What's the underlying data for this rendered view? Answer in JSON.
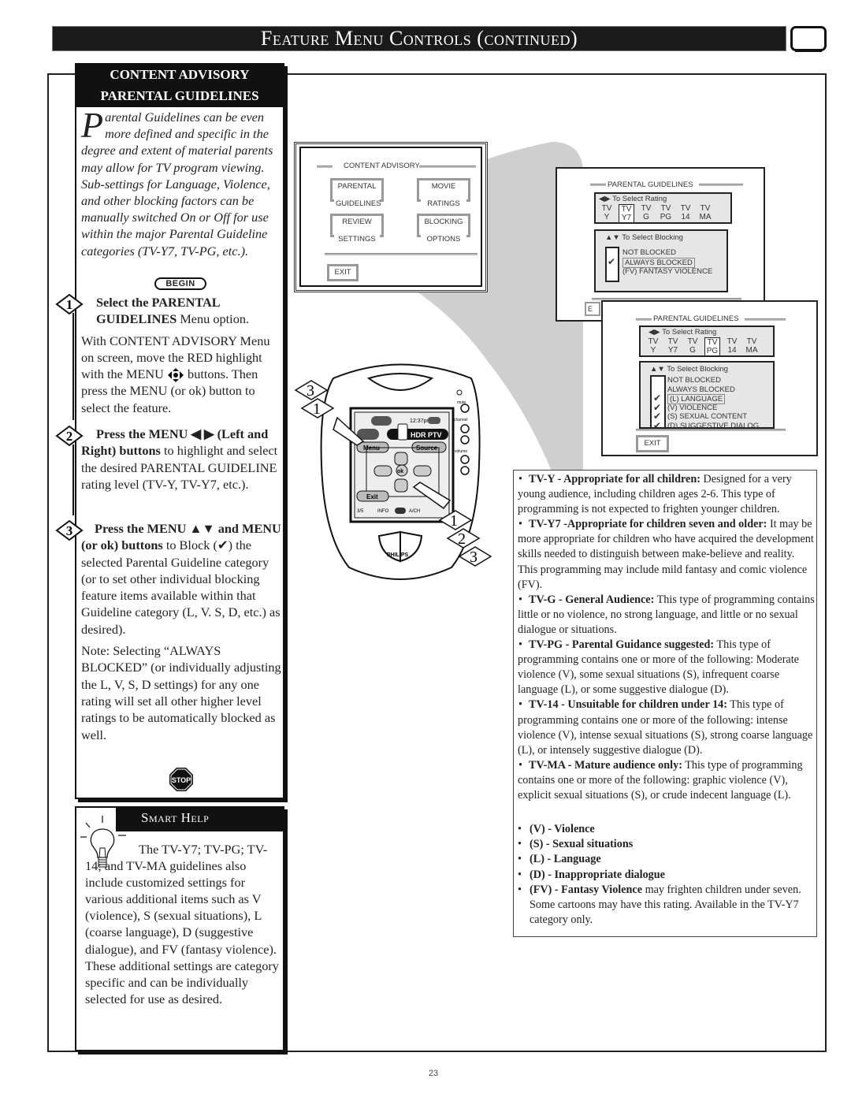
{
  "header": {
    "title": "Feature Menu Controls (continued)",
    "tv_icon": "tv-screen-icon"
  },
  "intro": {
    "heading_line1": "CONTENT ADVISORY",
    "heading_line2": "PARENTAL GUIDELINES",
    "dropcap": "P",
    "body": "arental Guidelines can be even more defined and specific in the degree and extent of material parents may allow for TV program viewing. Sub-settings for Language, Violence, and other blocking factors can be manually switched On or Off for use within the major Parental Guideline categories (TV-Y7, TV-PG, etc.).",
    "begin_label": "BEGIN"
  },
  "steps": [
    {
      "number": "1",
      "bold_lead": "Select the PARENTAL GUIDELINES",
      "lead_rest": " Menu option.",
      "body": "With CONTENT ADVISORY Menu on screen, move the RED highlight with the MENU ",
      "body_icon": "four-way-arrows-icon",
      "body_rest": " buttons. Then press the MENU (or ok) button to select the feature."
    },
    {
      "number": "2",
      "bold_lead": "Press the MENU ◀ ▶ (Left and Right) buttons",
      "lead_rest": " to highlight and select the desired PARENTAL GUIDELINE rating level (TV-Y, TV-Y7, etc.)."
    },
    {
      "number": "3",
      "bold_lead": "Press the MENU ▲▼ and MENU (or ok) buttons",
      "lead_rest": " to Block (✔) the selected Parental Guideline category (or to set other individual  blocking feature items available within that Guideline category (L, V. S, D, etc.) as desired).",
      "note": "Note: Selecting “ALWAYS BLOCKED” (or individually adjusting the L, V, S, D settings) for any one rating will set all other higher level ratings to be automatically blocked as well."
    }
  ],
  "stop_label": "STOP",
  "smart_help": {
    "title": "Smart Help",
    "body": "The TV-Y7; TV-PG; TV-14; and TV-MA guidelines also include customized settings for various additional items such as V (violence), S (sexual situations), L (coarse language), D (suggestive dialogue), and FV (fantasy violence). These additional settings are category specific and can be individually selected for use as desired."
  },
  "screen1": {
    "title": "CONTENT ADVISORY",
    "buttons": [
      {
        "line1": "PARENTAL",
        "line2": "GUIDELINES"
      },
      {
        "line1": "MOVIE",
        "line2": "RATINGS"
      },
      {
        "line1": "REVIEW",
        "line2": "SETTINGS"
      },
      {
        "line1": "BLOCKING",
        "line2": "OPTIONS"
      }
    ],
    "exit": "EXIT"
  },
  "screen2": {
    "title": "PARENTAL GUIDELINES",
    "rating_hint": "To Select Rating",
    "ratings": [
      {
        "top": "TV",
        "bottom": "Y"
      },
      {
        "top": "TV",
        "bottom": "Y7"
      },
      {
        "top": "TV",
        "bottom": "G"
      },
      {
        "top": "TV",
        "bottom": "PG"
      },
      {
        "top": "TV",
        "bottom": "14"
      },
      {
        "top": "TV",
        "bottom": "MA"
      }
    ],
    "selected_rating": "Y7",
    "blocking_hint": "To Select Blocking",
    "items": [
      {
        "label": "NOT BLOCKED",
        "checked": false,
        "highlight": false
      },
      {
        "label": "ALWAYS BLOCKED",
        "checked": true,
        "highlight": true
      },
      {
        "label": "(FV) FANTASY VIOLENCE",
        "checked": false,
        "highlight": false
      }
    ],
    "exit": "EXIT"
  },
  "screen3": {
    "title": "PARENTAL GUIDELINES",
    "rating_hint": "To Select Rating",
    "ratings": [
      {
        "top": "TV",
        "bottom": "Y"
      },
      {
        "top": "TV",
        "bottom": "Y7"
      },
      {
        "top": "TV",
        "bottom": "G"
      },
      {
        "top": "TV",
        "bottom": "PG"
      },
      {
        "top": "TV",
        "bottom": "14"
      },
      {
        "top": "TV",
        "bottom": "MA"
      }
    ],
    "selected_rating": "PG",
    "blocking_hint": "To Select Blocking",
    "items": [
      {
        "label": "NOT BLOCKED",
        "checked": false,
        "highlight": false
      },
      {
        "label": "ALWAYS BLOCKED",
        "checked": false,
        "highlight": false
      },
      {
        "label": "(L) LANGUAGE",
        "checked": true,
        "highlight": true
      },
      {
        "label": "(V) VIOLENCE",
        "checked": true,
        "highlight": false
      },
      {
        "label": "(S) SEXUAL CONTENT",
        "checked": true,
        "highlight": false
      },
      {
        "label": "(D) SUGGESTIVE DIALOG",
        "checked": true,
        "highlight": false
      }
    ],
    "exit": "EXIT"
  },
  "remote": {
    "brand": "PHILIPS",
    "time": "12:37pm",
    "device": "HDR PTV",
    "menu": "Menu",
    "source": "Source",
    "ok": "ok",
    "exit": "Exit",
    "page": "3/5",
    "info": "INFO",
    "av": "A/CH",
    "mute": "mute",
    "channel": "channel",
    "volume": "volume",
    "callouts_left": [
      "3",
      "1"
    ],
    "callouts_right": [
      "1",
      "2",
      "3"
    ]
  },
  "ratings_info": [
    {
      "bold": "TV-Y - Appropriate for all children:",
      "text": " Designed for a very young audience, including children ages 2-6. This type of programming is not expected to frighten younger children."
    },
    {
      "bold": "TV-Y7 -Appropriate for children seven and older:",
      "text": " It may be more appropriate for children who have acquired the development skills needed to distinguish between make-believe and reality. This programming may include mild fantasy and comic violence (FV)."
    },
    {
      "bold": "TV-G - General Audience:",
      "text": " This type of programming contains little or no violence, no strong language, and little or no sexual dialogue or situations."
    },
    {
      "bold": "TV-PG - Parental Guidance suggested:",
      "text": " This type of programming contains one or more of the following: Moderate violence (V), some sexual situations (S), infrequent coarse language (L), or some suggestive dialogue (D)."
    },
    {
      "bold": "TV-14 - Unsuitable for children under 14:",
      "text": " This type of programming contains one or more of the following: intense violence (V), intense sexual situations (S), strong coarse language (L), or intensely suggestive dialogue (D)."
    },
    {
      "bold": "TV-MA - Mature audience only:",
      "text": " This type of programming contains one or more of the following: graphic violence (V), explicit sexual situations (S), or crude indecent language (L)."
    }
  ],
  "content_codes": [
    {
      "bold": "(V) - Violence",
      "text": ""
    },
    {
      "bold": "(S) - Sexual situations",
      "text": ""
    },
    {
      "bold": "(L) - Language",
      "text": ""
    },
    {
      "bold": "(D) - Inappropriate dialogue",
      "text": ""
    },
    {
      "bold": "(FV) - Fantasy Violence",
      "text": " may frighten children under seven. Some cartoons may have this rating. Available in the TV-Y7 category only."
    }
  ],
  "page_number": "23"
}
